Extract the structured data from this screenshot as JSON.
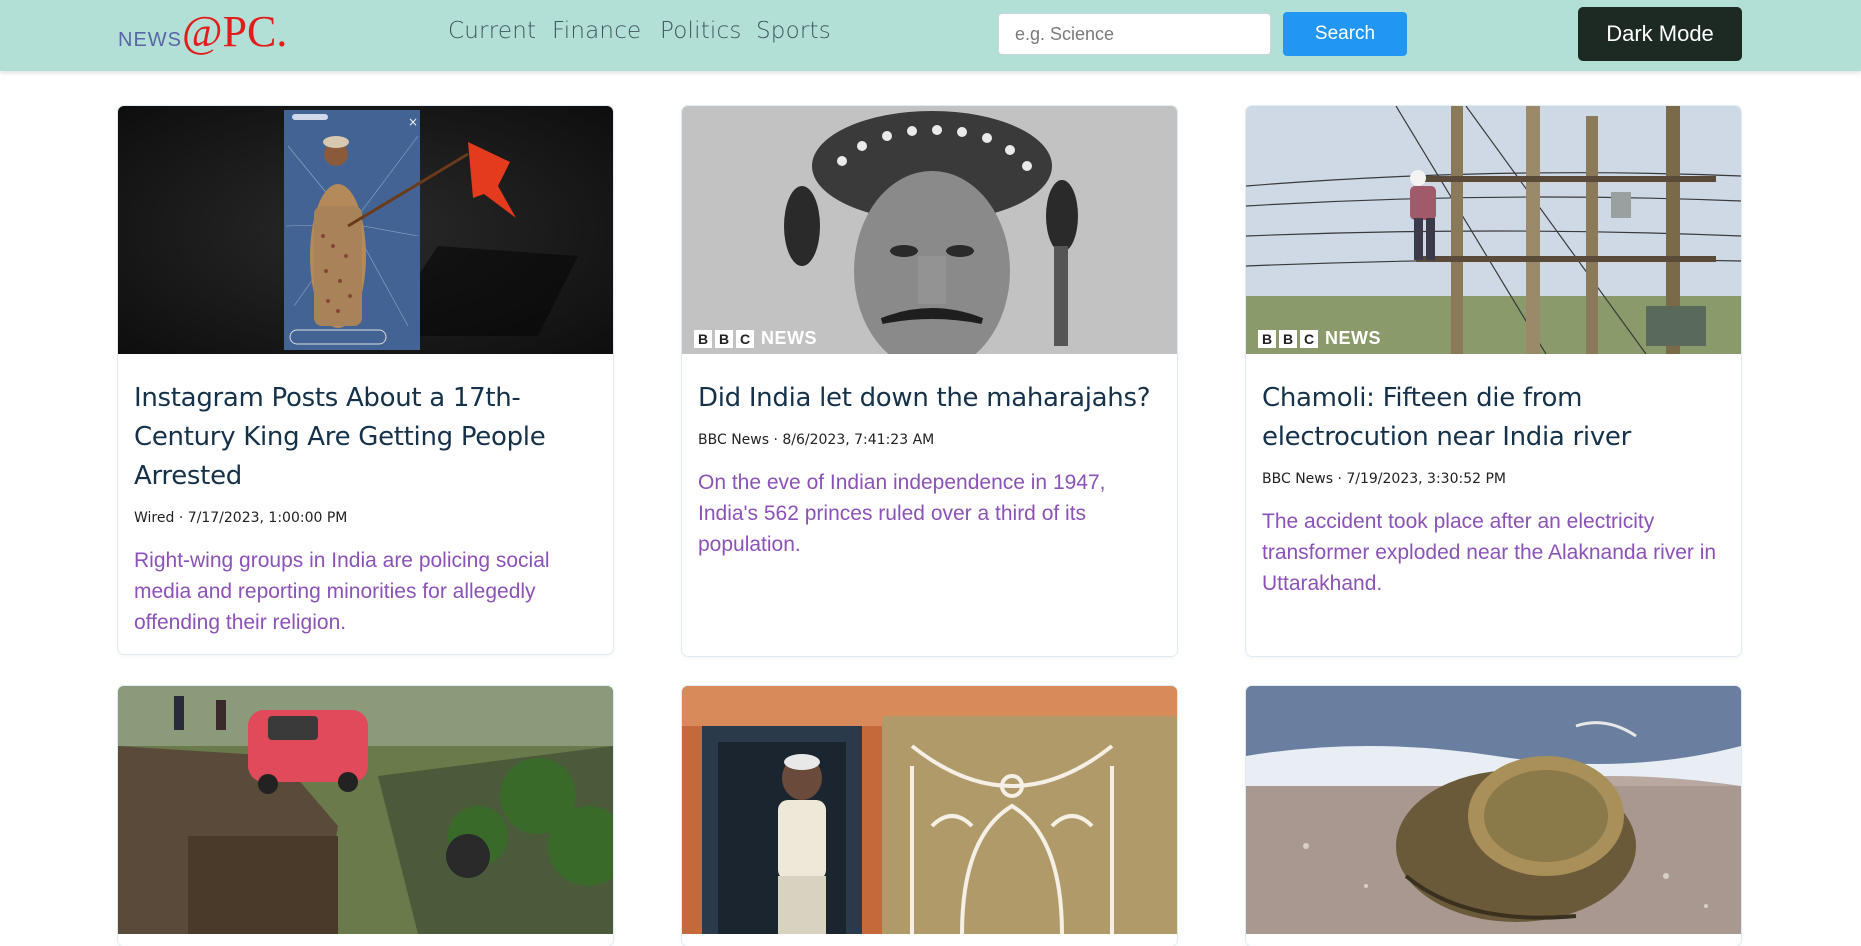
{
  "brand": {
    "news": "NEWS",
    "at": "@PC."
  },
  "nav": [
    {
      "label": "Current"
    },
    {
      "label": "Finance"
    },
    {
      "label": "Politics"
    },
    {
      "label": "Sports"
    }
  ],
  "search": {
    "placeholder": "e.g. Science",
    "value": "",
    "button": "Search"
  },
  "dark_mode_label": "Dark Mode",
  "colors": {
    "navbar": "#b3e0d6",
    "search_button": "#2196f3",
    "dark_button": "#1d2a24",
    "title": "#16324a",
    "description": "#8c52b8",
    "brand_at": "#e21b1b"
  },
  "watermark": {
    "boxes": [
      "B",
      "B",
      "C"
    ],
    "word": "NEWS"
  },
  "articles": [
    {
      "title": "Instagram Posts About a 17th-Century King Are Getting People Arrested",
      "meta": "Wired · 7/17/2023, 1:00:00 PM",
      "description": "Right-wing groups in India are policing social media and reporting minorities for allegedly offending their religion.",
      "image": "instagram-story-king-illustration"
    },
    {
      "title": "Did India let down the maharajahs?",
      "meta": "BBC News · 8/6/2023, 7:41:23 AM",
      "description": "On the eve of Indian independence in 1947, India's 562 princes ruled over a third of its population.",
      "image": "maharaja-portrait-photo"
    },
    {
      "title": "Chamoli: Fifteen die from electrocution near India river",
      "meta": "BBC News · 7/19/2023, 3:30:52 PM",
      "description": "The accident took place after an electricity transformer exploded near the Alaknanda river in Uttarakhand.",
      "image": "power-lines-worker-photo"
    },
    {
      "image": "car-on-cliff-photo"
    },
    {
      "image": "painted-house-doorway-photo"
    },
    {
      "image": "metal-object-on-beach-photo"
    }
  ]
}
